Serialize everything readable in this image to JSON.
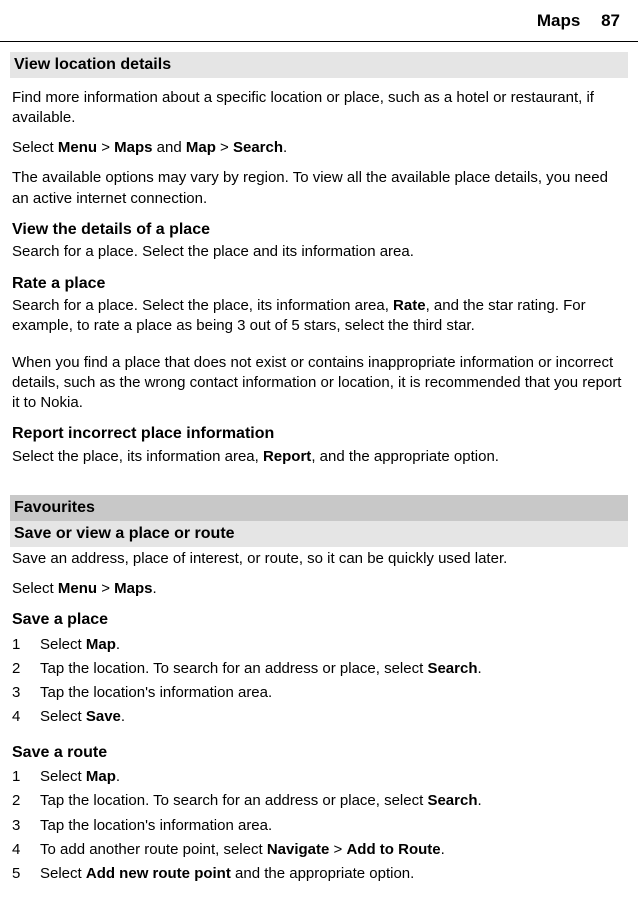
{
  "header": {
    "section": "Maps",
    "page": "87"
  },
  "s1": {
    "title": "View location details",
    "p1": "Find more information about a specific location or place, such as a hotel or restaurant, if available.",
    "p2a": "Select ",
    "p2b": "Menu",
    "p2c": " > ",
    "p2d": "Maps",
    "p2e": " and ",
    "p2f": "Map",
    "p2g": " > ",
    "p2h": "Search",
    "p2i": ".",
    "p3": "The available options may vary by region. To view all the available place details, you need an active internet connection."
  },
  "s2": {
    "h": "View the details of a place",
    "p": "Search for a place. Select the place and its information area."
  },
  "s3": {
    "h": "Rate a place",
    "p1a": "Search for a place. Select the place, its information area, ",
    "p1b": "Rate",
    "p1c": ", and the star rating. For example, to rate a place as being 3 out of 5 stars, select the third star.",
    "p2": "When you find a place that does not exist or contains inappropriate information or incorrect details, such as the wrong contact information or location, it is recommended that you report it to Nokia."
  },
  "s4": {
    "h": "Report incorrect place information",
    "p1a": "Select the place, its information area, ",
    "p1b": "Report",
    "p1c": ", and the appropriate option."
  },
  "s5": {
    "title": "Favourites",
    "subtitle": "Save or view a place or route",
    "p1": "Save an address, place of interest, or route, so it can be quickly used later.",
    "p2a": "Select ",
    "p2b": "Menu",
    "p2c": " > ",
    "p2d": "Maps",
    "p2e": "."
  },
  "s6": {
    "h": "Save a place",
    "items": [
      {
        "n": "1",
        "a": "Select ",
        "b": "Map",
        "c": "."
      },
      {
        "n": "2",
        "a": "Tap the location. To search for an address or place, select ",
        "b": "Search",
        "c": "."
      },
      {
        "n": "3",
        "a": "Tap the location's information area.",
        "b": "",
        "c": ""
      },
      {
        "n": "4",
        "a": "Select ",
        "b": "Save",
        "c": "."
      }
    ]
  },
  "s7": {
    "h": "Save a route",
    "items": [
      {
        "n": "1",
        "a": "Select ",
        "b": "Map",
        "c": "."
      },
      {
        "n": "2",
        "a": "Tap the location. To search for an address or place, select ",
        "b": "Search",
        "c": "."
      },
      {
        "n": "3",
        "a": "Tap the location's information area.",
        "b": "",
        "c": ""
      },
      {
        "n": "4",
        "a": "To add another route point, select ",
        "b": "Navigate",
        "c": " > ",
        "d": "Add to Route",
        "e": "."
      },
      {
        "n": "5",
        "a": "Select ",
        "b": "Add new route point",
        "c": " and the appropriate option."
      }
    ]
  }
}
